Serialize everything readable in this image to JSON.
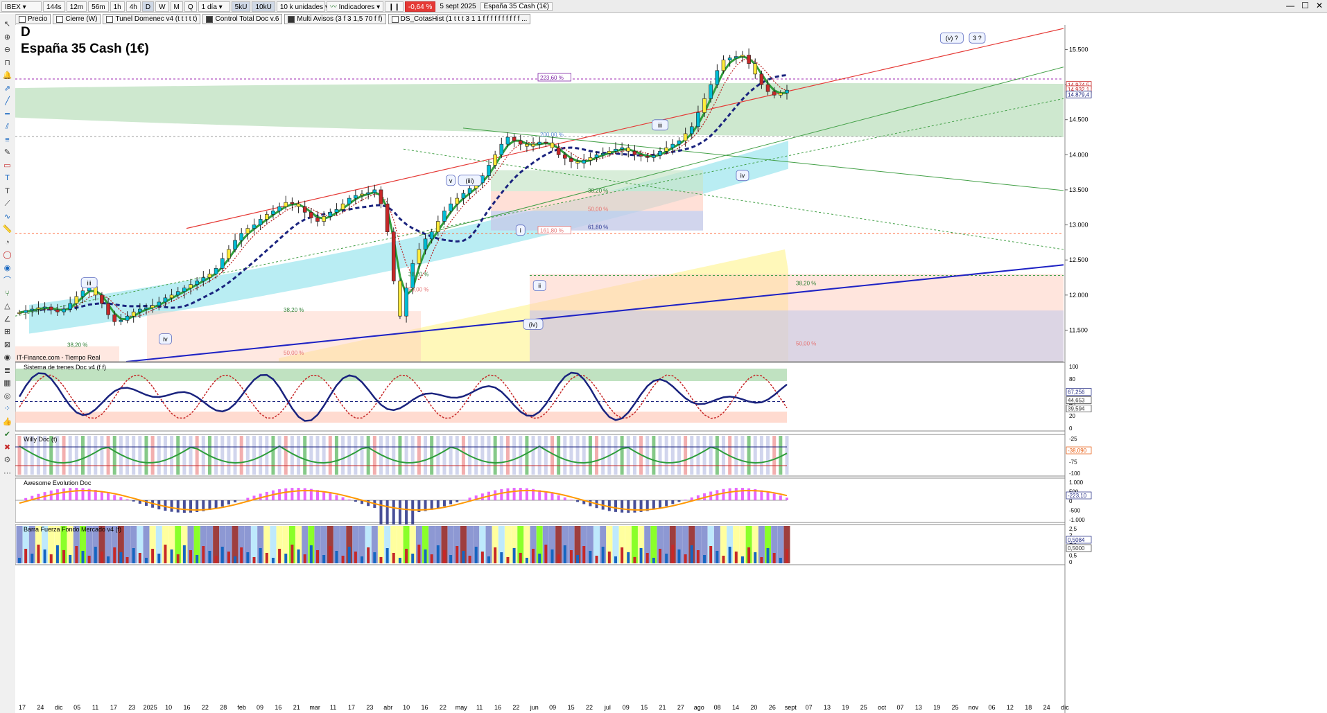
{
  "toolbar": {
    "symbol": "IBEX",
    "timeframes": [
      "144s",
      "12m",
      "56m",
      "1h",
      "4h",
      "D",
      "W",
      "M",
      "Q"
    ],
    "active_timeframe": "D",
    "period": "1 día",
    "units_buttons": [
      "5kU",
      "10kU"
    ],
    "active_unit": "10kU",
    "units_select": "10 k unidades",
    "indicators_label": "Indicadores",
    "change_pct": "-0,64 %",
    "date": "5 sept 2025",
    "instrument": "España 35 Cash (1€)"
  },
  "indicator_tabs": [
    {
      "label": "Precio",
      "checked": false
    },
    {
      "label": "Cierre (W)",
      "checked": false
    },
    {
      "label": "Tunel Domenec v4 (t t t t t)",
      "checked": false
    },
    {
      "label": "Control Total Doc v.6",
      "checked": true
    },
    {
      "label": "Multi Avisos (3 f 3 1,5 70 f f)",
      "checked": true
    },
    {
      "label": "DS_CotasHist (1 t t t 3 1 1 f f f f f f f f f f ...",
      "checked": false
    }
  ],
  "chart_data": {
    "type": "candlestick",
    "title_letter": "D",
    "title": "España 35 Cash (1€)",
    "source_note": "IT-Finance.com - Tiempo Real",
    "y_ticks": [
      11500,
      12000,
      12500,
      13000,
      13500,
      14000,
      14500,
      15000,
      15500
    ],
    "y_tick_labels": [
      "11.500",
      "12.000",
      "12.500",
      "13.000",
      "13.500",
      "14.000",
      "14.500",
      "15.000",
      "15.500"
    ],
    "ylim": [
      11050,
      15850
    ],
    "price_labels": [
      {
        "text": "14.974,5",
        "value": 14974.5,
        "color": "#c62828"
      },
      {
        "text": "14.932,1",
        "value": 14932.1,
        "color": "#c62828"
      },
      {
        "text": "14.879,4",
        "value": 14879.4,
        "color": "#1a237e"
      }
    ],
    "x_tick_labels": [
      "17",
      "24",
      "dic",
      "05",
      "11",
      "17",
      "23",
      "2025",
      "10",
      "16",
      "22",
      "28",
      "feb",
      "09",
      "16",
      "21",
      "mar",
      "11",
      "17",
      "23",
      "abr",
      "10",
      "16",
      "22",
      "may",
      "11",
      "16",
      "22",
      "jun",
      "09",
      "15",
      "22",
      "jul",
      "09",
      "15",
      "21",
      "27",
      "ago",
      "08",
      "14",
      "20",
      "26",
      "sept",
      "07",
      "13",
      "19",
      "25",
      "oct",
      "07",
      "13",
      "19",
      "25",
      "nov",
      "06",
      "12",
      "18",
      "24",
      "dic"
    ],
    "ohlc_close": [
      11750,
      11780,
      11800,
      11820,
      11830,
      11790,
      11760,
      11800,
      11880,
      11980,
      12060,
      12120,
      12000,
      11880,
      11720,
      11620,
      11640,
      11700,
      11760,
      11800,
      11820,
      11850,
      11900,
      11960,
      12000,
      12050,
      12100,
      12150,
      12200,
      12250,
      12300,
      12380,
      12520,
      12650,
      12780,
      12880,
      12950,
      13000,
      13080,
      13150,
      13200,
      13260,
      13320,
      13300,
      13260,
      13180,
      13100,
      13050,
      13120,
      13180,
      13220,
      13300,
      13380,
      13420,
      13440,
      13460,
      13500,
      13300,
      12900,
      12200,
      11700,
      12100,
      12450,
      12650,
      12800,
      12900,
      13050,
      13200,
      13300,
      13380,
      13450,
      13520,
      13600,
      13700,
      13850,
      14000,
      14150,
      14250,
      14200,
      14150,
      14120,
      14150,
      14180,
      14170,
      14100,
      14000,
      13950,
      13900,
      13880,
      13920,
      13960,
      14000,
      14020,
      14050,
      14080,
      14100,
      14050,
      14000,
      13980,
      13960,
      13990,
      14050,
      14100,
      14150,
      14200,
      14300,
      14400,
      14600,
      14800,
      15000,
      15200,
      15350,
      15380,
      15400,
      15420,
      15300,
      15150,
      15000,
      14900,
      14850,
      14880,
      14920
    ],
    "annotations": [
      {
        "text": "iii",
        "value": 12170,
        "idx": 11
      },
      {
        "text": "iv",
        "value": 11370,
        "idx": 23
      },
      {
        "text": "v",
        "value": 13630,
        "idx": 68
      },
      {
        "text": "(iii)",
        "value": 13630,
        "idx": 71
      },
      {
        "text": "i",
        "value": 12920,
        "idx": 79
      },
      {
        "text": "ii",
        "value": 12130,
        "idx": 82
      },
      {
        "text": "(iv)",
        "value": 11580,
        "idx": 81
      },
      {
        "text": "iii",
        "value": 14420,
        "idx": 101
      },
      {
        "text": "iv",
        "value": 13700,
        "idx": 114
      },
      {
        "text": "(v) ?",
        "value": 15660,
        "idx": 147
      },
      {
        "text": "3 ?",
        "value": 15660,
        "idx": 151
      }
    ],
    "fib_labels": [
      {
        "text": "223,60 %",
        "value": 15080,
        "color": "#7b1fa2",
        "boxed": true
      },
      {
        "text": "200,00 %",
        "value": 14270,
        "color": "#5c8dd6",
        "boxed": false
      },
      {
        "text": "38,20 %",
        "value": 13470,
        "color": "#2e7d32",
        "boxed": false
      },
      {
        "text": "50,00 %",
        "value": 13210,
        "color": "#e57373",
        "boxed": false
      },
      {
        "text": "61,80 %",
        "value": 12950,
        "color": "#283593",
        "boxed": false
      },
      {
        "text": "161,80 %",
        "value": 12900,
        "color": "#e57373",
        "boxed": true
      },
      {
        "text": "38,20 %",
        "value": 12280,
        "color": "#2e7d32",
        "boxed": false
      },
      {
        "text": "38,20 %",
        "value": 12150,
        "color": "#2e7d32",
        "boxed": false
      },
      {
        "text": "50,00 %",
        "value": 12060,
        "color": "#e57373",
        "boxed": false
      },
      {
        "text": "38,20 %",
        "value": 11770,
        "color": "#2e7d32",
        "boxed": false
      },
      {
        "text": "38,20 %",
        "value": 11270,
        "color": "#2e7d32",
        "boxed": false
      },
      {
        "text": "50,00 %",
        "value": 11160,
        "color": "#e57373",
        "boxed": false
      },
      {
        "text": "50,00 %",
        "value": 11290,
        "color": "#e57373",
        "boxed": false
      }
    ]
  },
  "panels": [
    {
      "title": "Sistema de trenes Doc v4 (f f)",
      "ticks": [
        "100",
        "80",
        "60",
        "40",
        "20",
        "0"
      ],
      "labels": [
        {
          "text": "67,256",
          "color": "#1a237e"
        },
        {
          "text": "44,653",
          "color": "#333"
        },
        {
          "text": "39,594",
          "color": "#333"
        }
      ]
    },
    {
      "title": "Willy Doc (t)",
      "ticks": [
        "-25",
        "-50",
        "-75",
        "-100"
      ],
      "labels": [
        {
          "text": "-38,090",
          "color": "#e65100"
        }
      ]
    },
    {
      "title": "Awesome Evolution Doc",
      "ticks": [
        "1.000",
        "500",
        "0",
        "-500",
        "-1.000"
      ],
      "labels": [
        {
          "text": "-223,10",
          "color": "#1a237e"
        }
      ]
    },
    {
      "title": "Barra Fuerza Fondo Mercado v4 (f)",
      "ticks": [
        "2,5",
        "2",
        "1,5",
        "1",
        "0,5",
        "0"
      ],
      "labels": [
        {
          "text": "0,5084",
          "color": "#1a237e"
        },
        {
          "text": "0,5000",
          "color": "#333"
        }
      ]
    }
  ],
  "colors": {
    "bull": "#1565c0",
    "bear": "#c62828",
    "up": "#00e5ff",
    "down": "#ffeb3b",
    "trend_red": "#e53935",
    "trend_green": "#43a047",
    "trend_blue": "#1e22c4"
  }
}
